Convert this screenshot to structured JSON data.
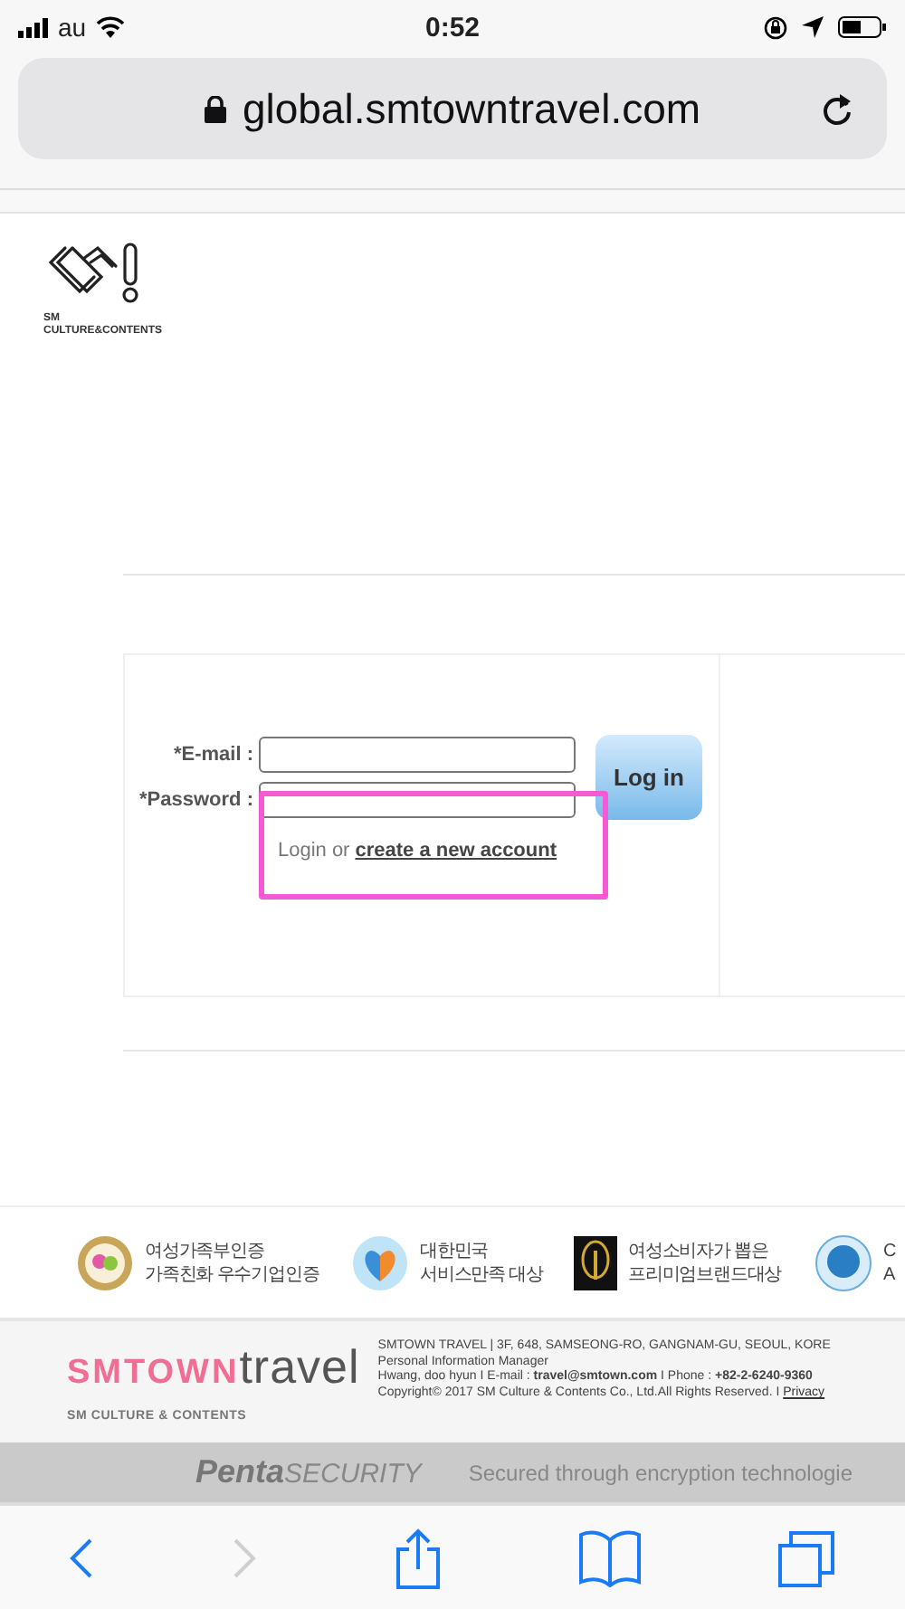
{
  "status_bar": {
    "carrier": "au",
    "time": "0:52"
  },
  "address_bar": {
    "url": "global.smtowntravel.com"
  },
  "header": {
    "logo_line_1": "SM",
    "logo_line_2": "CULTURE&CONTENTS"
  },
  "login_form": {
    "fields": [
      {
        "label": "*E-mail :"
      },
      {
        "label": "*Password :"
      }
    ],
    "button": "Log in",
    "prompt": "Login or",
    "link": "create a new account"
  },
  "badges": [
    {
      "kind": "seal",
      "lines": [
        "여성가족부인증",
        "가족친화 우수기업인증"
      ]
    },
    {
      "kind": "heart",
      "lines": [
        "대한민국",
        "서비스만족 대상"
      ]
    },
    {
      "kind": "emblem",
      "lines": [
        "여성소비자가 뽑은",
        "프리미엄브랜드대상"
      ]
    },
    {
      "kind": "round",
      "lines": [
        "C",
        "A"
      ]
    }
  ],
  "footer": {
    "brand_primary": "SMTOWN",
    "brand_secondary": "travel",
    "tagline": "SM CULTURE & CONTENTS",
    "lines": [
      "SMTOWN TRAVEL | 3F, 648, SAMSEONG-RO, GANGNAM-GU, SEOUL, KORE",
      "Personal Information Manager",
      "Hwang, doo hyun I E-mail : **travel@smtown.com** I Phone : **+82-2-6240-9360**",
      "Copyright© 2017 SM Culture & Contents Co., Ltd.All Rights Reserved. I"
    ],
    "privacy_link": "Privacy"
  },
  "security_bar": {
    "brand_bold": "Penta",
    "brand_light": "SECURITY",
    "message": "Secured through encryption technologie"
  },
  "toolbar": [
    {
      "kind": "back",
      "disabled": false
    },
    {
      "kind": "forward",
      "disabled": true
    },
    {
      "kind": "share",
      "disabled": false
    },
    {
      "kind": "bookmarks",
      "disabled": false
    },
    {
      "kind": "tabs",
      "disabled": false
    }
  ]
}
